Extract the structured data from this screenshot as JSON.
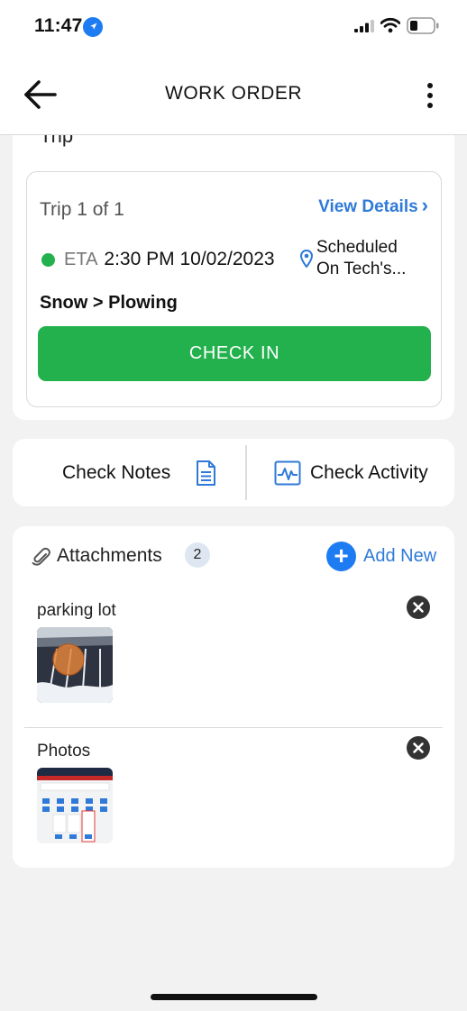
{
  "status_bar": {
    "time": "11:47"
  },
  "header": {
    "title": "WORK ORDER"
  },
  "trip": {
    "section_title": "Trip",
    "count_label": "Trip 1 of 1",
    "view_details_label": "View Details",
    "eta_label": "ETA",
    "eta_value": "2:30 PM 10/02/2023",
    "status_line1": "Scheduled",
    "status_line2": "On Tech's...",
    "category": "Snow > Plowing",
    "checkin_label": "CHECK IN"
  },
  "checks": {
    "notes_label": "Check Notes",
    "activity_label": "Check Activity"
  },
  "attachments": {
    "title": "Attachments",
    "count": "2",
    "add_label": "Add New",
    "items": [
      {
        "name": "parking lot",
        "thumb_icon": "parking-lot-photo"
      },
      {
        "name": "Photos",
        "thumb_icon": "screenshot-photo"
      }
    ]
  },
  "colors": {
    "accent_blue": "#2f7ad9",
    "check_in_green": "#22b14c",
    "eta_dot_green": "#22b14c"
  }
}
